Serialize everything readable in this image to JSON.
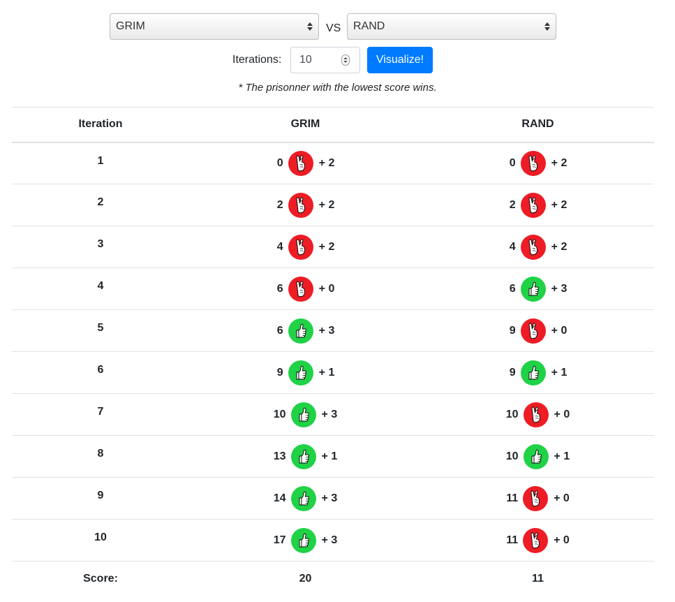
{
  "controls": {
    "player1": "GRIM",
    "vs_label": "VS",
    "player2": "RAND",
    "iterations_label": "Iterations:",
    "iterations_value": "10",
    "visualize_label": "Visualize!",
    "note": "* The prisonner with the lowest score wins."
  },
  "colors": {
    "defect": "#ee1c25",
    "cooperate": "#1fd246",
    "button": "#007bff"
  },
  "table": {
    "headers": [
      "Iteration",
      "GRIM",
      "RAND"
    ],
    "rows": [
      {
        "iteration": "1",
        "p1": {
          "score": "0",
          "move": "defect",
          "gain": "+ 2"
        },
        "p2": {
          "score": "0",
          "move": "defect",
          "gain": "+ 2"
        }
      },
      {
        "iteration": "2",
        "p1": {
          "score": "2",
          "move": "defect",
          "gain": "+ 2"
        },
        "p2": {
          "score": "2",
          "move": "defect",
          "gain": "+ 2"
        }
      },
      {
        "iteration": "3",
        "p1": {
          "score": "4",
          "move": "defect",
          "gain": "+ 2"
        },
        "p2": {
          "score": "4",
          "move": "defect",
          "gain": "+ 2"
        }
      },
      {
        "iteration": "4",
        "p1": {
          "score": "6",
          "move": "defect",
          "gain": "+ 0"
        },
        "p2": {
          "score": "6",
          "move": "cooperate",
          "gain": "+ 3"
        }
      },
      {
        "iteration": "5",
        "p1": {
          "score": "6",
          "move": "cooperate",
          "gain": "+ 3"
        },
        "p2": {
          "score": "9",
          "move": "defect",
          "gain": "+ 0"
        }
      },
      {
        "iteration": "6",
        "p1": {
          "score": "9",
          "move": "cooperate",
          "gain": "+ 1"
        },
        "p2": {
          "score": "9",
          "move": "cooperate",
          "gain": "+ 1"
        }
      },
      {
        "iteration": "7",
        "p1": {
          "score": "10",
          "move": "cooperate",
          "gain": "+ 3"
        },
        "p2": {
          "score": "10",
          "move": "defect",
          "gain": "+ 0"
        }
      },
      {
        "iteration": "8",
        "p1": {
          "score": "13",
          "move": "cooperate",
          "gain": "+ 1"
        },
        "p2": {
          "score": "10",
          "move": "cooperate",
          "gain": "+ 1"
        }
      },
      {
        "iteration": "9",
        "p1": {
          "score": "14",
          "move": "cooperate",
          "gain": "+ 3"
        },
        "p2": {
          "score": "11",
          "move": "defect",
          "gain": "+ 0"
        }
      },
      {
        "iteration": "10",
        "p1": {
          "score": "17",
          "move": "cooperate",
          "gain": "+ 3"
        },
        "p2": {
          "score": "11",
          "move": "defect",
          "gain": "+ 0"
        }
      }
    ],
    "footer": {
      "label": "Score:",
      "p1": "20",
      "p2": "11"
    }
  }
}
